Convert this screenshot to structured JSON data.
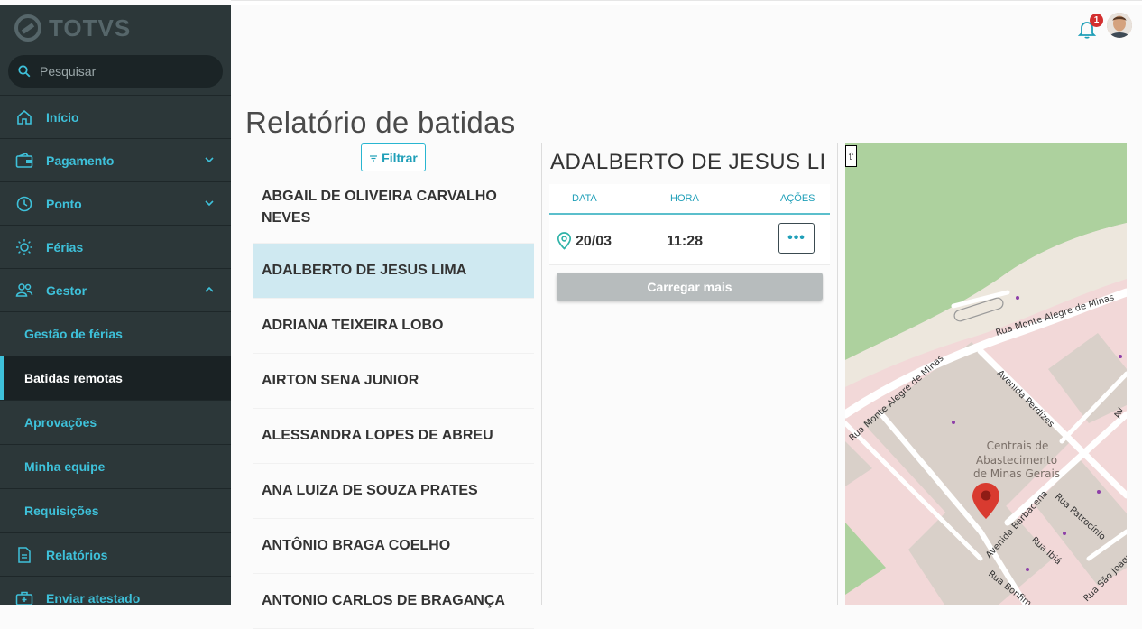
{
  "app": {
    "logo_text": "TOTVS"
  },
  "search": {
    "placeholder": "Pesquisar"
  },
  "sidebar": {
    "items": [
      {
        "label": "Início",
        "icon": "home-icon"
      },
      {
        "label": "Pagamento",
        "icon": "wallet-icon"
      },
      {
        "label": "Ponto",
        "icon": "clock-icon"
      },
      {
        "label": "Férias",
        "icon": "sun-icon"
      },
      {
        "label": "Gestor",
        "icon": "team-icon"
      }
    ],
    "gestor_sub": [
      {
        "label": "Gestão de férias"
      },
      {
        "label": "Batidas remotas",
        "active": true
      },
      {
        "label": "Aprovações"
      },
      {
        "label": "Minha equipe"
      },
      {
        "label": "Requisições"
      }
    ],
    "bottom_items": [
      {
        "label": "Relatórios",
        "icon": "document-icon"
      },
      {
        "label": "Enviar atestado",
        "icon": "medical-kit-icon"
      }
    ]
  },
  "header": {
    "notification_count": "1"
  },
  "page": {
    "title": "Relatório de batidas"
  },
  "filter": {
    "label": "Filtrar"
  },
  "employees": [
    "ABGAIL DE OLIVEIRA CARVALHO NEVES",
    "ADALBERTO DE JESUS LIMA",
    "ADRIANA TEIXEIRA LOBO",
    "AIRTON SENA JUNIOR",
    "ALESSANDRA LOPES DE ABREU",
    "ANA LUIZA DE SOUZA PRATES",
    "ANTÔNIO BRAGA COELHO",
    "ANTONIO CARLOS DE BRAGANÇA"
  ],
  "detail": {
    "name": "ADALBERTO DE JESUS LI...",
    "columns": {
      "date": "DATA",
      "hour": "HORA",
      "actions": "AÇÕES"
    },
    "rows": [
      {
        "date": "20/03",
        "hour": "11:28",
        "actions": "•••"
      }
    ],
    "load_more": "Carregar mais"
  },
  "map": {
    "labels": {
      "street1": "Rua Monte Alegre de Minas",
      "street2": "Rua Monte Alegre de Minas",
      "avenue1": "Avenida Perdizes",
      "avenue2": "Avenida Barbacena",
      "street3": "Rua Patrocínio",
      "street4": "Rua Ibiá",
      "street5": "Rua Bonfim",
      "street6": "Rua São Joaquim",
      "avenue3": "Av",
      "place_line1": "Centrais de",
      "place_line2": "Abastecimento",
      "place_line3": "de Minas Gerais"
    },
    "toggle": "⇧",
    "colors": {
      "park": "#add19e",
      "block": "#d9d0c9",
      "road": "#ffffff",
      "marker": "#d93b30"
    }
  }
}
